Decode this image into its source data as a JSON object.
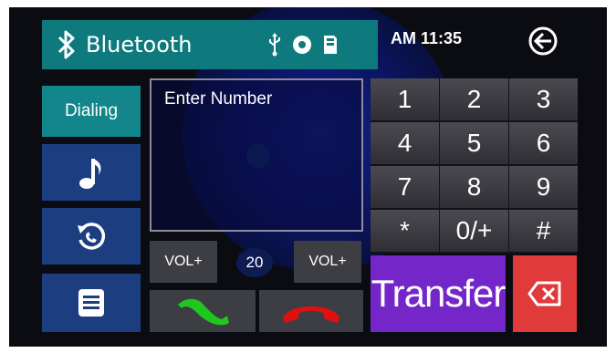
{
  "header": {
    "title": "Bluetooth",
    "icons": [
      "usb-icon",
      "disc-icon",
      "sd-card-icon"
    ]
  },
  "clock": "AM 11:35",
  "back_icon": "back-arrow-icon",
  "sidebar": {
    "items": [
      {
        "label": "Dialing",
        "active": true
      },
      {
        "icon": "music-note-icon"
      },
      {
        "icon": "recent-calls-icon"
      },
      {
        "icon": "menu-list-icon"
      }
    ]
  },
  "number_input": {
    "placeholder": "Enter Number"
  },
  "volume": {
    "down_label": "VOL+",
    "value": "20",
    "up_label": "VOL+"
  },
  "keypad": {
    "keys": [
      "1",
      "2",
      "3",
      "4",
      "5",
      "6",
      "7",
      "8",
      "9",
      "*",
      "0/+",
      "#"
    ]
  },
  "actions": {
    "call_icon": "call-answer-icon",
    "hangup_icon": "call-hangup-icon",
    "transfer_label": "Transfer",
    "delete_icon": "backspace-icon"
  },
  "colors": {
    "teal": "#0f7a7e",
    "side_blue": "#1c3e80",
    "transfer": "#7526c8",
    "delete": "#e03a3a",
    "answer": "#1ec81e",
    "hangup": "#e01010"
  }
}
